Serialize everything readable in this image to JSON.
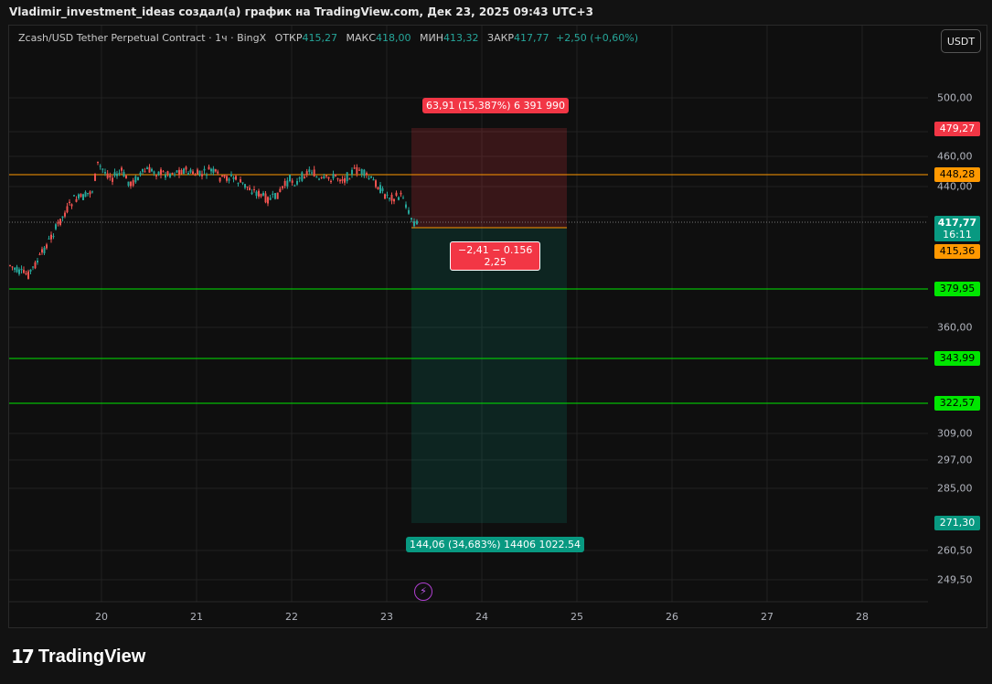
{
  "header": {
    "title": "Vladimir_investment_ideas создал(а) график на TradingView.com, Дек 23, 2025 09:43 UTC+3"
  },
  "legend": {
    "symbol": "Zcash/USD Tether Perpetual Contract · 1ч · BingX",
    "open_label": "ОТКР",
    "open": "415,27",
    "high_label": "МАКС",
    "high": "418,00",
    "low_label": "МИН",
    "low": "413,32",
    "close_label": "ЗАКР",
    "close": "417,77",
    "change": "+2,50 (+0,60%)"
  },
  "toolbar": {
    "currency": "USDT"
  },
  "price_axis": {
    "ticks": [
      "500,00",
      "460,00",
      "440,00",
      "360,00",
      "309,00",
      "297,00",
      "285,00",
      "260,50",
      "249,50"
    ],
    "tags": {
      "stop": "479,27",
      "resistance": "448,28",
      "current_price": "417,77",
      "countdown": "16:11",
      "entry": "415,36",
      "support1": "379,95",
      "support2": "343,99",
      "support3": "322,57",
      "target": "271,30"
    }
  },
  "time_axis": {
    "labels": [
      "20",
      "21",
      "22",
      "23",
      "24",
      "25",
      "26",
      "27",
      "28"
    ]
  },
  "position": {
    "profit_label": "63,91 (15,387%) 6 391 990",
    "center_line1": "−2,41 − 0.156",
    "center_line2": "2,25",
    "target_label": "144,06 (34,683%) 14406 1022.54"
  },
  "colors": {
    "stop": "#f23645",
    "resistance": "#ff9800",
    "support": "#00e600",
    "target": "#089981",
    "up": "#26a69a",
    "down": "#ef5350"
  },
  "brand": {
    "name": "TradingView",
    "logo_icon": "tradingview-logo-icon"
  },
  "icons": {
    "event": "lightning-icon"
  }
}
